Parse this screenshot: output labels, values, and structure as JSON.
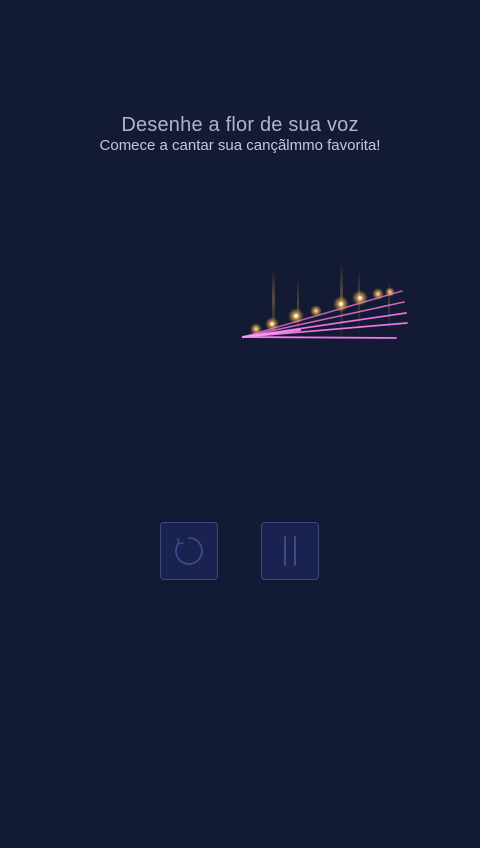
{
  "header": {
    "title": "Desenhe a flor de sua voz",
    "subtitle": "Comece a cantar sua cançãlmmo favorita!"
  },
  "controls": {
    "restart_icon": "restart-circle-icon",
    "pause_icon": "pause-icon"
  },
  "colors": {
    "background": "#131a33",
    "petal_lines": "#e46ad6",
    "sparkle": "#ffd27a",
    "button_border": "#3b4882"
  }
}
